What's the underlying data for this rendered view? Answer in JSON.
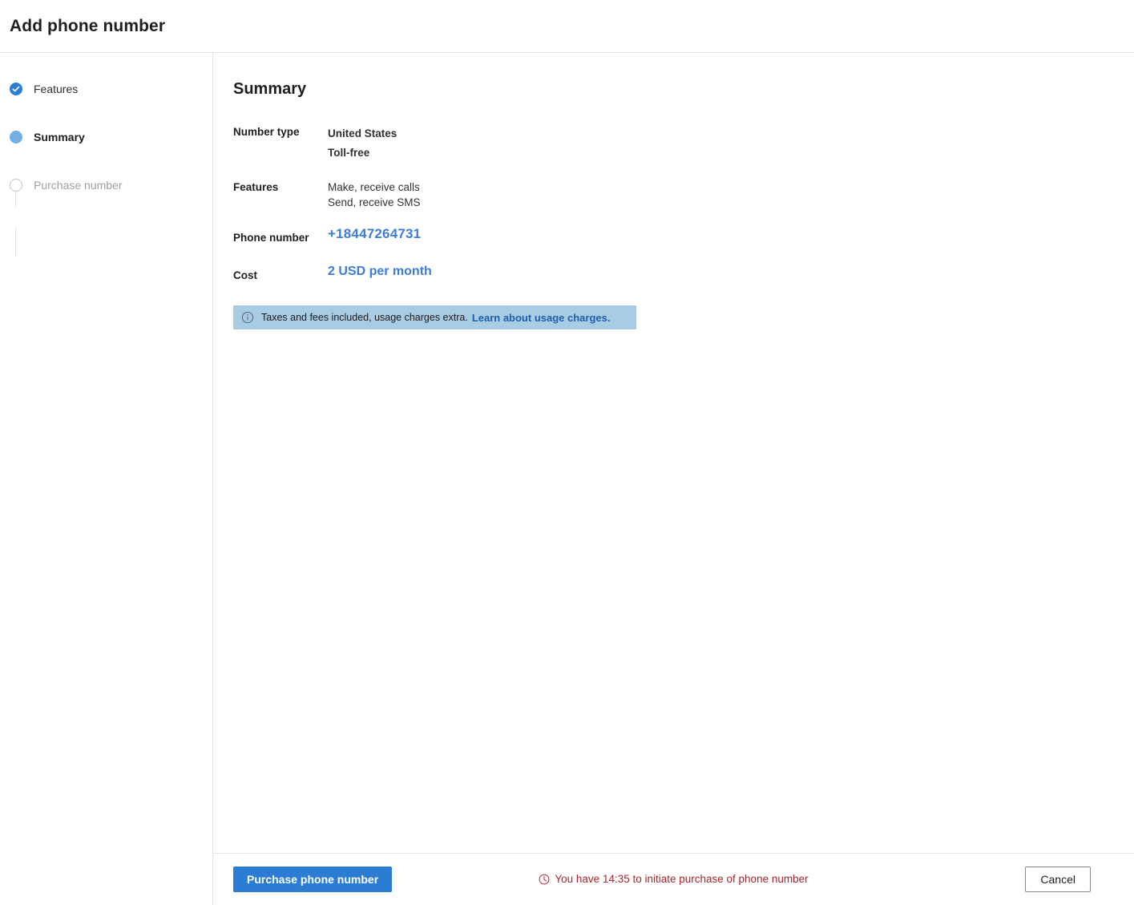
{
  "header": {
    "title": "Add phone number"
  },
  "wizard": {
    "steps": [
      {
        "label": "Features",
        "state": "done",
        "icon": "check-icon"
      },
      {
        "label": "Summary",
        "state": "current",
        "icon": "filled-circle-icon"
      },
      {
        "label": "Purchase number",
        "state": "todo",
        "icon": "empty-circle-icon"
      }
    ]
  },
  "main": {
    "title": "Summary",
    "rows": {
      "number_type": {
        "label": "Number type",
        "value_line1": "United States",
        "value_line2": "Toll-free"
      },
      "features": {
        "label": "Features",
        "value_line1": "Make, receive calls",
        "value_line2": "Send, receive SMS"
      },
      "phone_number": {
        "label": "Phone number",
        "value": "+18447264731"
      },
      "cost": {
        "label": "Cost",
        "value": "2 USD per month"
      }
    },
    "info_banner": {
      "icon": "info-icon",
      "text": "Taxes and fees included, usage charges extra.",
      "link_text": "Learn about usage charges.",
      "background": "#a9cce5",
      "link_color": "#1d5fa8"
    },
    "timer": {
      "icon": "clock-icon",
      "text": "You have 14:35 to initiate purchase of phone number",
      "color": "#a4262c"
    }
  },
  "footer": {
    "primary_label": "Purchase phone number",
    "secondary_label": "Cancel",
    "primary_color": "#2b7cd3"
  }
}
